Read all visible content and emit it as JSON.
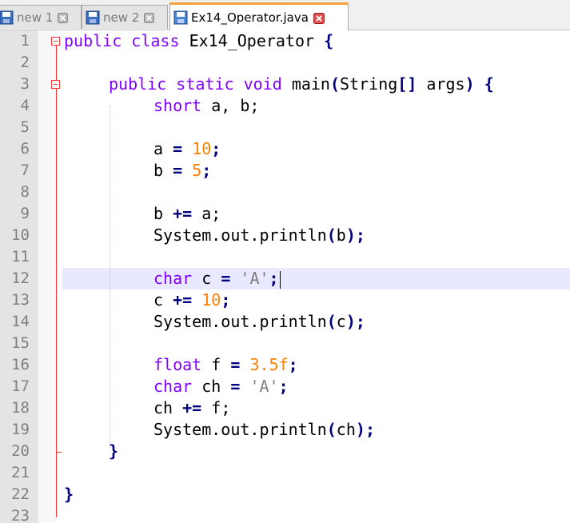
{
  "tabs": [
    {
      "label": "new 1",
      "active": false,
      "saved": true
    },
    {
      "label": "new 2",
      "active": false,
      "saved": true
    },
    {
      "label": "Ex14_Operator.java",
      "active": true,
      "saved": true
    }
  ],
  "editor": {
    "current_line": 12,
    "line_numbers": [
      "1",
      "2",
      "3",
      "4",
      "5",
      "6",
      "7",
      "8",
      "9",
      "10",
      "11",
      "12",
      "13",
      "14",
      "15",
      "16",
      "17",
      "18",
      "19",
      "20",
      "21",
      "22",
      "23"
    ],
    "tokens": {
      "l1_kw1": "public",
      "l1_kw2": "class",
      "l1_name": "Ex14_Operator",
      "l1_brace": "{",
      "l3_kw1": "public",
      "l3_kw2": "static",
      "l3_kw3": "void",
      "l3_name": "main",
      "l3_p1": "(",
      "l3_type": "String",
      "l3_br": "[]",
      "l3_arg": "args",
      "l3_p2": ")",
      "l3_brace": "{",
      "l4_type": "short",
      "l4_rest": "a, b;",
      "l6_var": "a",
      "l6_op": "=",
      "l6_num": "10",
      "l6_end": ";",
      "l7_var": "b",
      "l7_op": "=",
      "l7_num": "5",
      "l7_end": ";",
      "l9_var": "b",
      "l9_op": "+=",
      "l9_rest": "a;",
      "l10_a": "System.out.println",
      "l10_p1": "(",
      "l10_b": "b",
      "l10_p2": ")",
      "l10_end": ";",
      "l12_type": "char",
      "l12_var": "c",
      "l12_op": "=",
      "l12_str": "'A'",
      "l12_end": ";",
      "l13_var": "c",
      "l13_op": "+=",
      "l13_num": "10",
      "l13_end": ";",
      "l14_a": "System.out.println",
      "l14_p1": "(",
      "l14_b": "c",
      "l14_p2": ")",
      "l14_end": ";",
      "l16_type": "float",
      "l16_var": "f",
      "l16_op": "=",
      "l16_num": "3.5f",
      "l16_end": ";",
      "l17_type": "char",
      "l17_var": "ch",
      "l17_op": "=",
      "l17_str": "'A'",
      "l17_end": ";",
      "l18_var": "ch",
      "l18_op": "+=",
      "l18_rest": "f;",
      "l19_a": "System.out.println",
      "l19_p1": "(",
      "l19_b": "ch",
      "l19_p2": ")",
      "l19_end": ";",
      "l20_brace": "}",
      "l22_brace": "}"
    }
  },
  "colors": {
    "keyword": "#8000ff",
    "number": "#ff8000",
    "string": "#808080",
    "operator": "#000080",
    "active_tab_accent": "#f7a13a",
    "current_line": "#e8e8ff",
    "fold_marker": "#ff3333"
  },
  "icons": {
    "tab_doc": "floppy-disk-icon",
    "tab_close": "close-icon",
    "fold": "fold-minus-icon"
  }
}
